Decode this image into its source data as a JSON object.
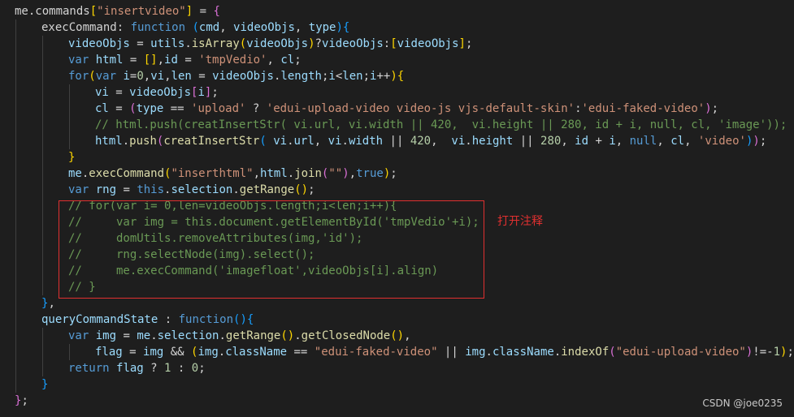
{
  "editor": {
    "colors": {
      "background": "#1e1e1e",
      "keyword": "#569cd6",
      "string": "#ce9178",
      "function": "#dcdcaa",
      "variable": "#9cdcfe",
      "number": "#b5cea8",
      "comment": "#6a9955",
      "annotation": "#e03030"
    },
    "lines": [
      {
        "indent": 0,
        "tokens": [
          [
            "op",
            "me.commands"
          ],
          [
            "bracket-y",
            "["
          ],
          [
            "str",
            "\"insertvideo\""
          ],
          [
            "bracket-y",
            "]"
          ],
          [
            "op",
            " = "
          ],
          [
            "bracket-p",
            "{"
          ]
        ]
      },
      {
        "indent": 1,
        "tokens": [
          [
            "op",
            "execCommand"
          ],
          [
            "op",
            ": "
          ],
          [
            "kw",
            "function"
          ],
          [
            "op",
            " "
          ],
          [
            "bracket-b",
            "("
          ],
          [
            "var",
            "cmd"
          ],
          [
            "op",
            ", "
          ],
          [
            "var",
            "videoObjs"
          ],
          [
            "op",
            ", "
          ],
          [
            "var",
            "type"
          ],
          [
            "bracket-b",
            ")"
          ],
          [
            "bracket-b",
            "{"
          ]
        ]
      },
      {
        "indent": 2,
        "tokens": [
          [
            "var",
            "videoObjs"
          ],
          [
            "op",
            " = "
          ],
          [
            "var",
            "utils"
          ],
          [
            "op",
            "."
          ],
          [
            "fn",
            "isArray"
          ],
          [
            "bracket-y",
            "("
          ],
          [
            "var",
            "videoObjs"
          ],
          [
            "bracket-y",
            ")"
          ],
          [
            "op",
            "?"
          ],
          [
            "var",
            "videoObjs"
          ],
          [
            "op",
            ":"
          ],
          [
            "bracket-y",
            "["
          ],
          [
            "var",
            "videoObjs"
          ],
          [
            "bracket-y",
            "]"
          ],
          [
            "op",
            ";"
          ]
        ]
      },
      {
        "indent": 2,
        "tokens": [
          [
            "kw",
            "var"
          ],
          [
            "op",
            " "
          ],
          [
            "var",
            "html"
          ],
          [
            "op",
            " = "
          ],
          [
            "bracket-y",
            "[]"
          ],
          [
            "op",
            ","
          ],
          [
            "var",
            "id"
          ],
          [
            "op",
            " = "
          ],
          [
            "str",
            "'tmpVedio'"
          ],
          [
            "op",
            ", "
          ],
          [
            "var",
            "cl"
          ],
          [
            "op",
            ";"
          ]
        ]
      },
      {
        "indent": 2,
        "tokens": [
          [
            "kw",
            "for"
          ],
          [
            "bracket-y",
            "("
          ],
          [
            "kw",
            "var"
          ],
          [
            "op",
            " "
          ],
          [
            "var",
            "i"
          ],
          [
            "op",
            "="
          ],
          [
            "num",
            "0"
          ],
          [
            "op",
            ","
          ],
          [
            "var",
            "vi"
          ],
          [
            "op",
            ","
          ],
          [
            "var",
            "len"
          ],
          [
            "op",
            " = "
          ],
          [
            "var",
            "videoObjs"
          ],
          [
            "op",
            "."
          ],
          [
            "var",
            "length"
          ],
          [
            "op",
            ";"
          ],
          [
            "var",
            "i"
          ],
          [
            "op",
            "<"
          ],
          [
            "var",
            "len"
          ],
          [
            "op",
            ";"
          ],
          [
            "var",
            "i"
          ],
          [
            "op",
            "++"
          ],
          [
            "bracket-y",
            ")"
          ],
          [
            "bracket-y",
            "{"
          ]
        ]
      },
      {
        "indent": 3,
        "tokens": [
          [
            "var",
            "vi"
          ],
          [
            "op",
            " = "
          ],
          [
            "var",
            "videoObjs"
          ],
          [
            "bracket-p",
            "["
          ],
          [
            "var",
            "i"
          ],
          [
            "bracket-p",
            "]"
          ],
          [
            "op",
            ";"
          ]
        ]
      },
      {
        "indent": 3,
        "tokens": [
          [
            "var",
            "cl"
          ],
          [
            "op",
            " = "
          ],
          [
            "bracket-p",
            "("
          ],
          [
            "var",
            "type"
          ],
          [
            "op",
            " == "
          ],
          [
            "str",
            "'upload'"
          ],
          [
            "op",
            " ? "
          ],
          [
            "str",
            "'edui-upload-video video-js vjs-default-skin'"
          ],
          [
            "op",
            ":"
          ],
          [
            "str",
            "'edui-faked-video'"
          ],
          [
            "bracket-p",
            ")"
          ],
          [
            "op",
            ";"
          ]
        ]
      },
      {
        "indent": 3,
        "tokens": [
          [
            "cm",
            "// html.push(creatInsertStr( vi.url, vi.width || 420,  vi.height || 280, id + i, null, cl, 'image'));"
          ]
        ]
      },
      {
        "indent": 3,
        "tokens": [
          [
            "var",
            "html"
          ],
          [
            "op",
            "."
          ],
          [
            "fn",
            "push"
          ],
          [
            "bracket-p",
            "("
          ],
          [
            "fn",
            "creatInsertStr"
          ],
          [
            "bracket-b",
            "("
          ],
          [
            "op",
            " "
          ],
          [
            "var",
            "vi"
          ],
          [
            "op",
            "."
          ],
          [
            "var",
            "url"
          ],
          [
            "op",
            ", "
          ],
          [
            "var",
            "vi"
          ],
          [
            "op",
            "."
          ],
          [
            "var",
            "width"
          ],
          [
            "op",
            " || "
          ],
          [
            "num",
            "420"
          ],
          [
            "op",
            ",  "
          ],
          [
            "var",
            "vi"
          ],
          [
            "op",
            "."
          ],
          [
            "var",
            "height"
          ],
          [
            "op",
            " || "
          ],
          [
            "num",
            "280"
          ],
          [
            "op",
            ", "
          ],
          [
            "var",
            "id"
          ],
          [
            "op",
            " + "
          ],
          [
            "var",
            "i"
          ],
          [
            "op",
            ", "
          ],
          [
            "kw",
            "null"
          ],
          [
            "op",
            ", "
          ],
          [
            "var",
            "cl"
          ],
          [
            "op",
            ", "
          ],
          [
            "str",
            "'video'"
          ],
          [
            "bracket-b",
            ")"
          ],
          [
            "bracket-p",
            ")"
          ],
          [
            "op",
            ";"
          ]
        ]
      },
      {
        "indent": 2,
        "tokens": [
          [
            "bracket-y",
            "}"
          ]
        ]
      },
      {
        "indent": 2,
        "tokens": [
          [
            "var",
            "me"
          ],
          [
            "op",
            "."
          ],
          [
            "fn",
            "execCommand"
          ],
          [
            "bracket-y",
            "("
          ],
          [
            "str",
            "\"inserthtml\""
          ],
          [
            "op",
            ","
          ],
          [
            "var",
            "html"
          ],
          [
            "op",
            "."
          ],
          [
            "fn",
            "join"
          ],
          [
            "bracket-p",
            "("
          ],
          [
            "str",
            "\"\""
          ],
          [
            "bracket-p",
            ")"
          ],
          [
            "op",
            ","
          ],
          [
            "kw",
            "true"
          ],
          [
            "bracket-y",
            ")"
          ],
          [
            "op",
            ";"
          ]
        ]
      },
      {
        "indent": 2,
        "tokens": [
          [
            "kw",
            "var"
          ],
          [
            "op",
            " "
          ],
          [
            "var",
            "rng"
          ],
          [
            "op",
            " = "
          ],
          [
            "kw",
            "this"
          ],
          [
            "op",
            "."
          ],
          [
            "var",
            "selection"
          ],
          [
            "op",
            "."
          ],
          [
            "fn",
            "getRange"
          ],
          [
            "bracket-y",
            "()"
          ],
          [
            "op",
            ";"
          ]
        ]
      },
      {
        "indent": 2,
        "tokens": [
          [
            "cm",
            "// for(var i= 0,len=videoObjs.length;i<len;i++){"
          ]
        ]
      },
      {
        "indent": 2,
        "tokens": [
          [
            "cm",
            "//     var img = this.document.getElementById('tmpVedio'+i);"
          ]
        ]
      },
      {
        "indent": 2,
        "tokens": [
          [
            "cm",
            "//     domUtils.removeAttributes(img,'id');"
          ]
        ]
      },
      {
        "indent": 2,
        "tokens": [
          [
            "cm",
            "//     rng.selectNode(img).select();"
          ]
        ]
      },
      {
        "indent": 2,
        "tokens": [
          [
            "cm",
            "//     me.execCommand('imagefloat',videoObjs[i].align)"
          ]
        ]
      },
      {
        "indent": 2,
        "tokens": [
          [
            "cm",
            "// }"
          ]
        ]
      },
      {
        "indent": 1,
        "tokens": [
          [
            "bracket-b",
            "}"
          ],
          [
            "op",
            ","
          ]
        ]
      },
      {
        "indent": 1,
        "tokens": [
          [
            "var",
            "queryCommandState"
          ],
          [
            "op",
            " : "
          ],
          [
            "kw",
            "function"
          ],
          [
            "bracket-b",
            "()"
          ],
          [
            "bracket-b",
            "{"
          ]
        ]
      },
      {
        "indent": 2,
        "tokens": [
          [
            "kw",
            "var"
          ],
          [
            "op",
            " "
          ],
          [
            "var",
            "img"
          ],
          [
            "op",
            " = "
          ],
          [
            "var",
            "me"
          ],
          [
            "op",
            "."
          ],
          [
            "var",
            "selection"
          ],
          [
            "op",
            "."
          ],
          [
            "fn",
            "getRange"
          ],
          [
            "bracket-y",
            "()"
          ],
          [
            "op",
            "."
          ],
          [
            "fn",
            "getClosedNode"
          ],
          [
            "bracket-y",
            "()"
          ],
          [
            "op",
            ","
          ]
        ]
      },
      {
        "indent": 3,
        "tokens": [
          [
            "var",
            "flag"
          ],
          [
            "op",
            " = "
          ],
          [
            "var",
            "img"
          ],
          [
            "op",
            " && "
          ],
          [
            "bracket-y",
            "("
          ],
          [
            "var",
            "img"
          ],
          [
            "op",
            "."
          ],
          [
            "var",
            "className"
          ],
          [
            "op",
            " == "
          ],
          [
            "str",
            "\"edui-faked-video\""
          ],
          [
            "op",
            " || "
          ],
          [
            "var",
            "img"
          ],
          [
            "op",
            "."
          ],
          [
            "var",
            "className"
          ],
          [
            "op",
            "."
          ],
          [
            "fn",
            "indexOf"
          ],
          [
            "bracket-p",
            "("
          ],
          [
            "str",
            "\"edui-upload-video\""
          ],
          [
            "bracket-p",
            ")"
          ],
          [
            "op",
            "!=-"
          ],
          [
            "num",
            "1"
          ],
          [
            "bracket-y",
            ")"
          ],
          [
            "op",
            ";"
          ]
        ]
      },
      {
        "indent": 2,
        "tokens": [
          [
            "kw",
            "return"
          ],
          [
            "op",
            " "
          ],
          [
            "var",
            "flag"
          ],
          [
            "op",
            " ? "
          ],
          [
            "num",
            "1"
          ],
          [
            "op",
            " : "
          ],
          [
            "num",
            "0"
          ],
          [
            "op",
            ";"
          ]
        ]
      },
      {
        "indent": 1,
        "tokens": [
          [
            "bracket-b",
            "}"
          ]
        ]
      },
      {
        "indent": 0,
        "tokens": [
          [
            "bracket-p",
            "}"
          ],
          [
            "op",
            ";"
          ]
        ]
      }
    ]
  },
  "annotation": {
    "text": "打开注释"
  },
  "watermark": {
    "text": "CSDN @joe0235"
  }
}
